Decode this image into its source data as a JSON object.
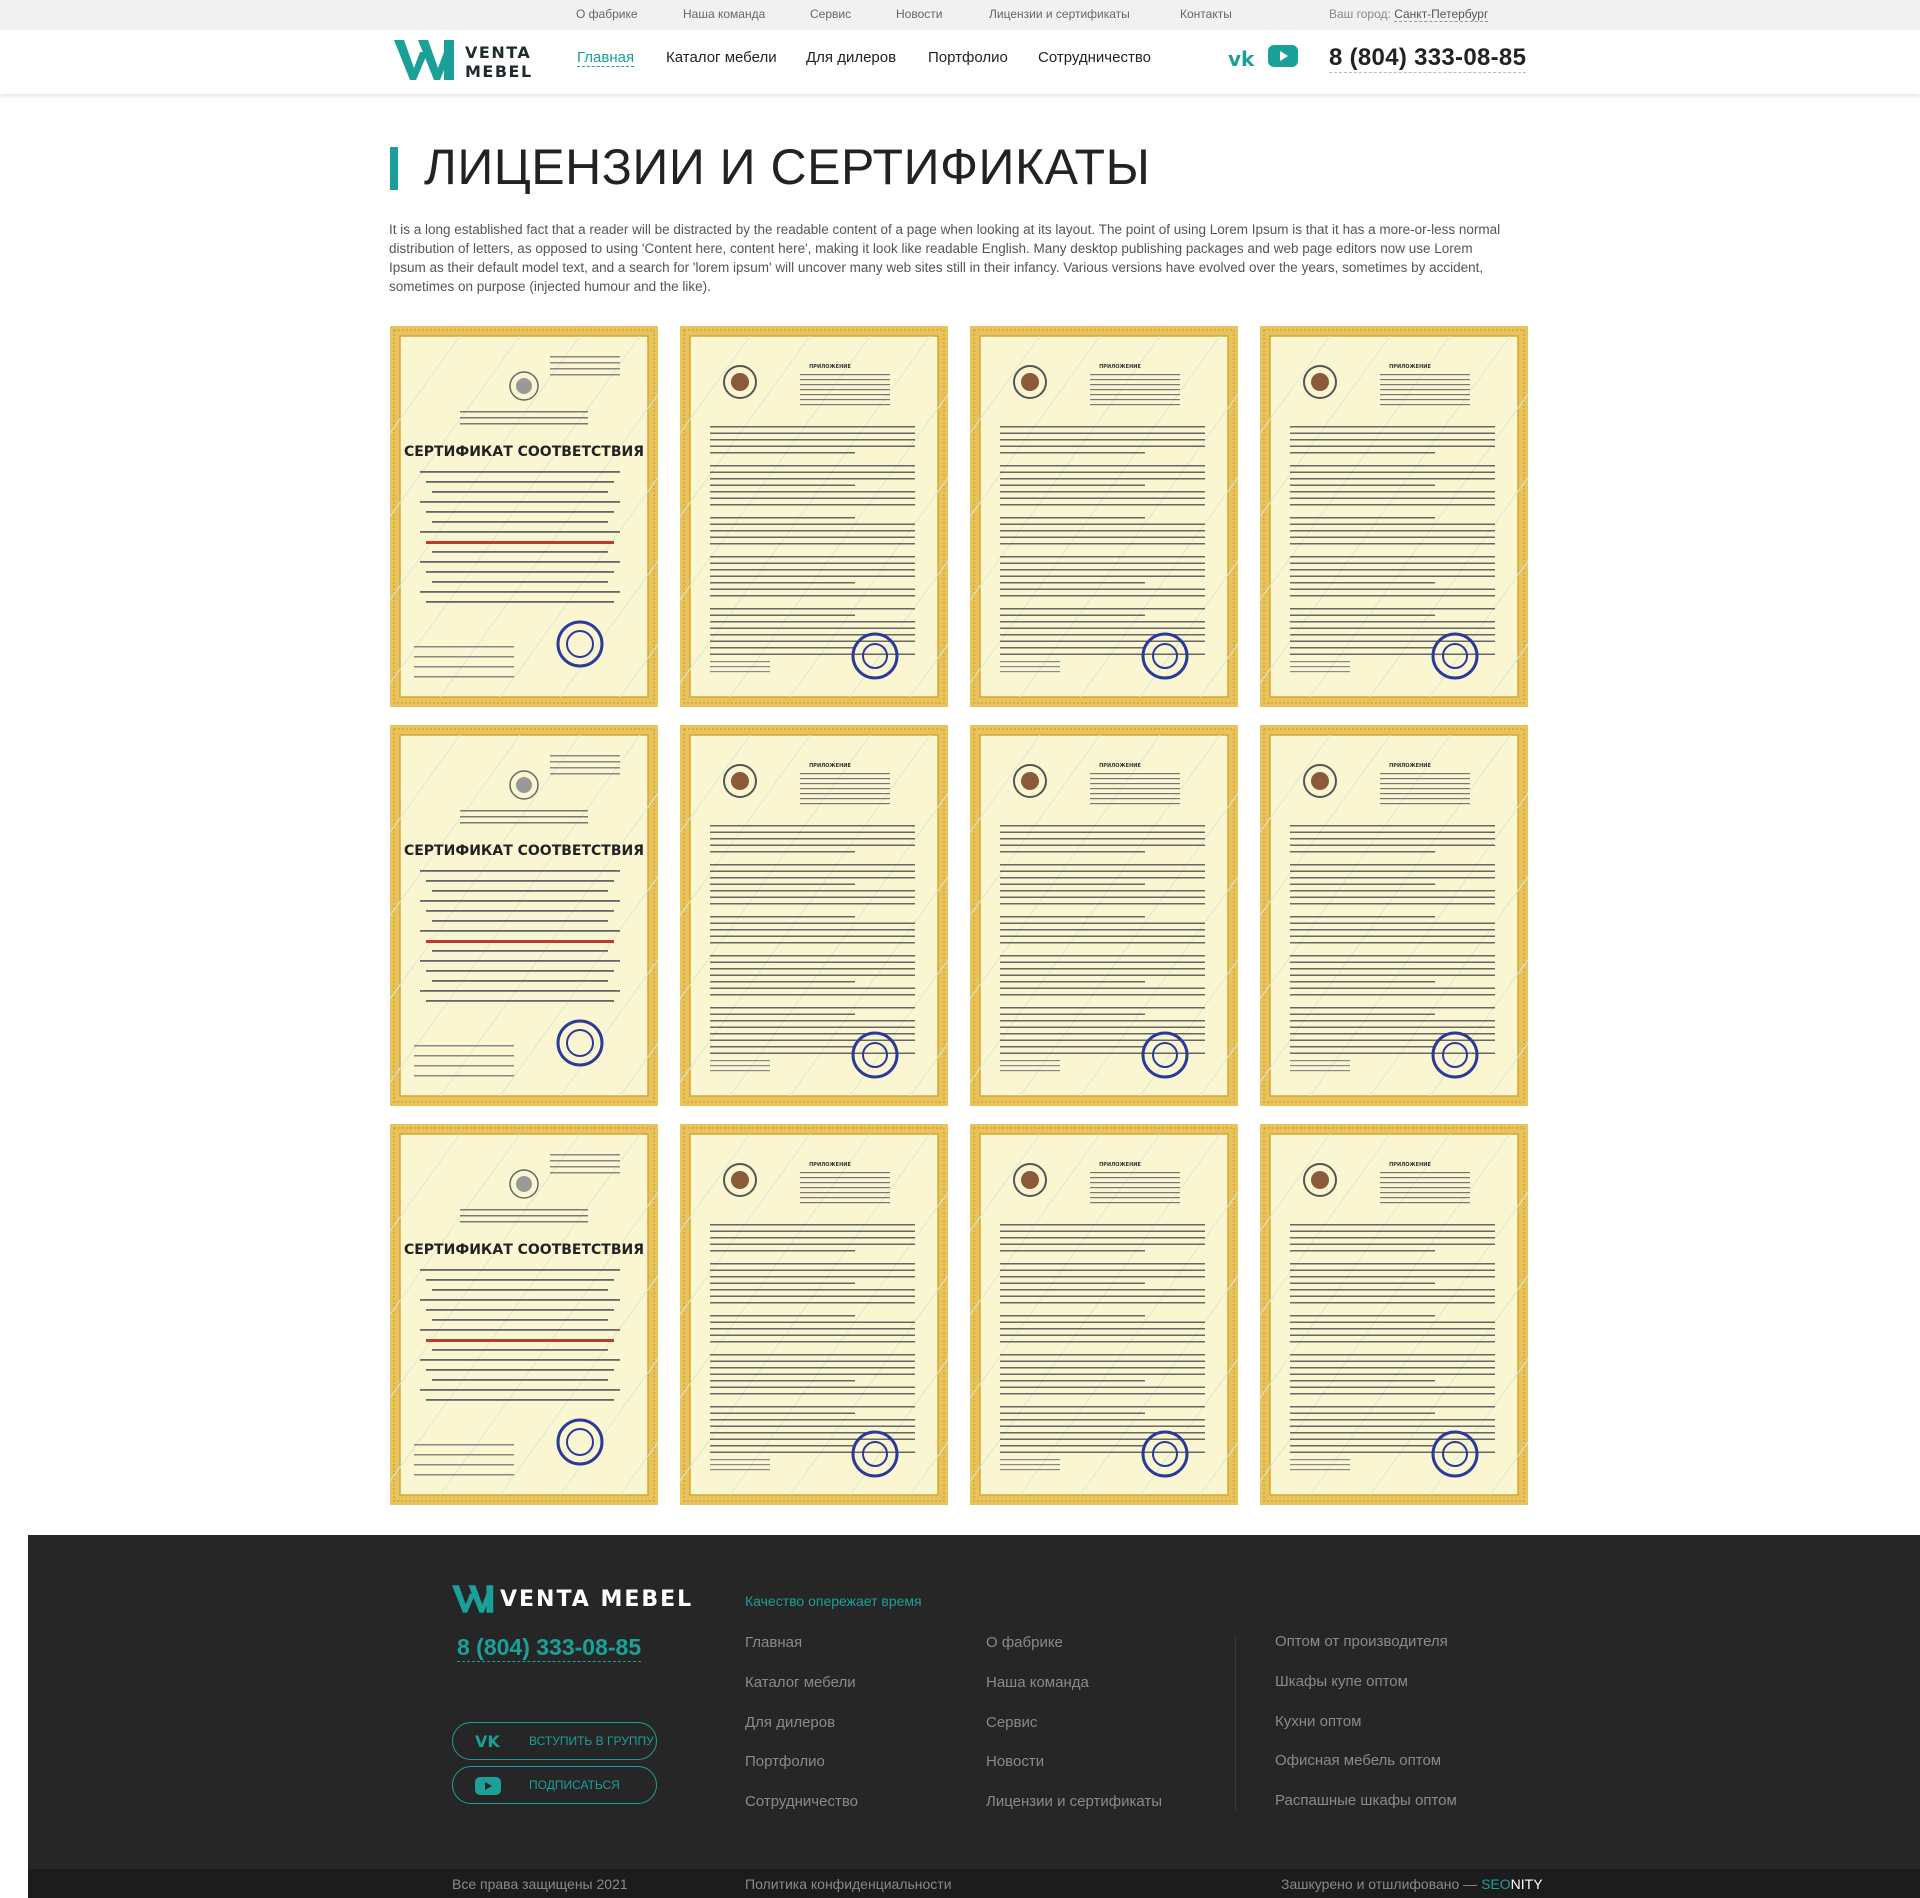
{
  "topbar": {
    "links": [
      "О фабрике",
      "Наша команда",
      "Сервис",
      "Новости",
      "Лицензии и сертификаты",
      "Контакты"
    ],
    "city_label": "Ваш город:",
    "city_name": "Санкт-Петербург"
  },
  "header": {
    "logo_line1": "VENTA",
    "logo_line2": "MEBEL",
    "nav": [
      "Главная",
      "Каталог мебели",
      "Для дилеров",
      "Портфолио",
      "Сотрудничество"
    ],
    "phone": "8 (804) 333-08-85",
    "social_icons": [
      "vk-icon",
      "youtube-icon"
    ]
  },
  "page": {
    "title": "ЛИЦЕНЗИИ И СЕРТИФИКАТЫ",
    "intro": "It is a long established fact that a reader will be distracted by the readable content of a page when looking at its layout. The point of using Lorem Ipsum is that it has a more-or-less normal distribution of letters, as opposed to using 'Content here, content here', making it look like readable English. Many desktop publishing packages and web page editors now use Lorem Ipsum as their default model text, and a search for 'lorem ipsum' will uncover many web sites still in their infancy. Various versions have evolved over the years, sometimes by accident, sometimes on purpose (injected humour and the like)."
  },
  "certificates": [
    {
      "type": "certificate",
      "heading": "СЕРТИФИКАТ СООТВЕТСТВИЯ"
    },
    {
      "type": "appendix",
      "heading": "ПРИЛОЖЕНИЕ"
    },
    {
      "type": "appendix",
      "heading": "ПРИЛОЖЕНИЕ"
    },
    {
      "type": "appendix",
      "heading": "ПРИЛОЖЕНИЕ"
    },
    {
      "type": "certificate",
      "heading": "СЕРТИФИКАТ СООТВЕТСТВИЯ"
    },
    {
      "type": "appendix",
      "heading": "ПРИЛОЖЕНИЕ"
    },
    {
      "type": "appendix",
      "heading": "ПРИЛОЖЕНИЕ"
    },
    {
      "type": "appendix",
      "heading": "ПРИЛОЖЕНИЕ"
    },
    {
      "type": "certificate",
      "heading": "СЕРТИФИКАТ СООТВЕТСТВИЯ"
    },
    {
      "type": "appendix",
      "heading": "ПРИЛОЖЕНИЕ"
    },
    {
      "type": "appendix",
      "heading": "ПРИЛОЖЕНИЕ"
    },
    {
      "type": "appendix",
      "heading": "ПРИЛОЖЕНИЕ"
    }
  ],
  "footer": {
    "logo_text": "VENTA MEBEL",
    "phone": "8 (804) 333-08-85",
    "vk_button": "вступить в группу",
    "yt_button": "подписаться",
    "slogan": "Качество опережает время",
    "col1": [
      "Главная",
      "Каталог мебели",
      "Для дилеров",
      "Портфолио",
      "Сотрудничество"
    ],
    "col2": [
      "О фабрике",
      "Наша команда",
      "Сервис",
      "Новости",
      "Лицензии и сертификаты"
    ],
    "col3": [
      "Оптом от производителя",
      "Шкафы купе оптом",
      "Кухни оптом",
      "Офисная мебель оптом",
      "Распашные шкафы оптом"
    ],
    "copyright": "Все права защищены 2021",
    "privacy": "Политика конфиденциальности",
    "credit_prefix": "Зашкурено и отшлифовано —",
    "credit_brand_a": "SEO",
    "credit_brand_b": "NITY"
  },
  "colors": {
    "accent": "#1aa098",
    "footer_bg": "#262626",
    "cert_border": "#e8c25a",
    "cert_paper": "#fbf6d2"
  }
}
